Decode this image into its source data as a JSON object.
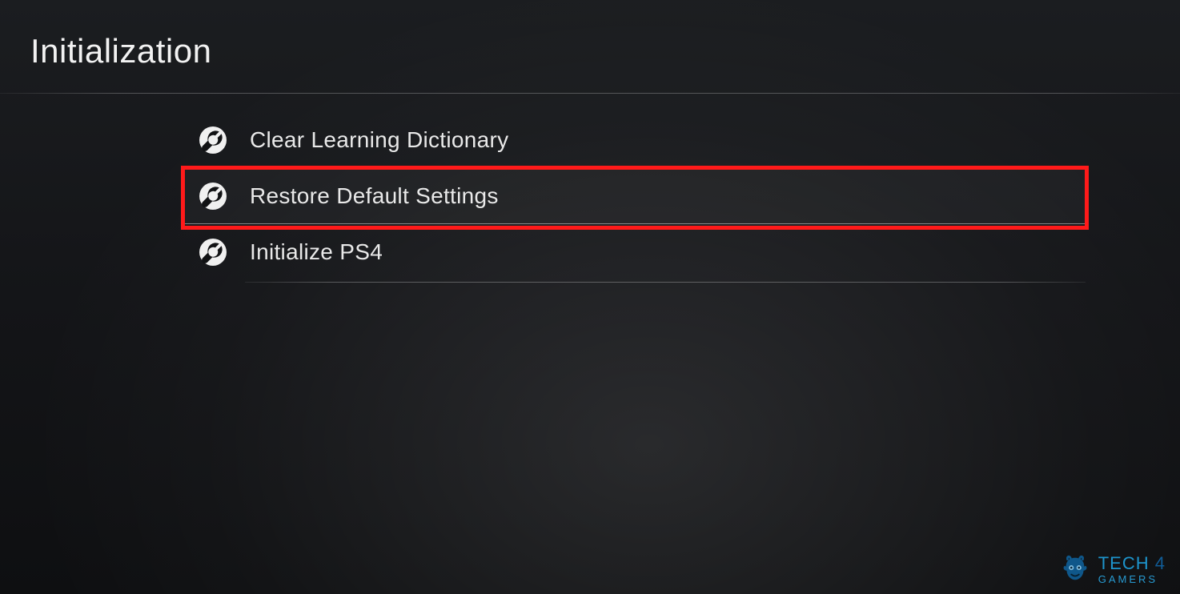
{
  "header": {
    "title": "Initialization"
  },
  "menu": {
    "items": [
      {
        "label": "Clear Learning Dictionary",
        "icon": "wrench-icon",
        "selected": false,
        "highlighted": false
      },
      {
        "label": "Restore Default Settings",
        "icon": "wrench-icon",
        "selected": true,
        "highlighted": true
      },
      {
        "label": "Initialize PS4",
        "icon": "wrench-icon",
        "selected": false,
        "highlighted": false
      }
    ]
  },
  "highlight": {
    "color": "#ff1a1a"
  },
  "watermark": {
    "brand_top_left": "TECH",
    "brand_top_right": "4",
    "brand_bottom": "GAMERS"
  }
}
